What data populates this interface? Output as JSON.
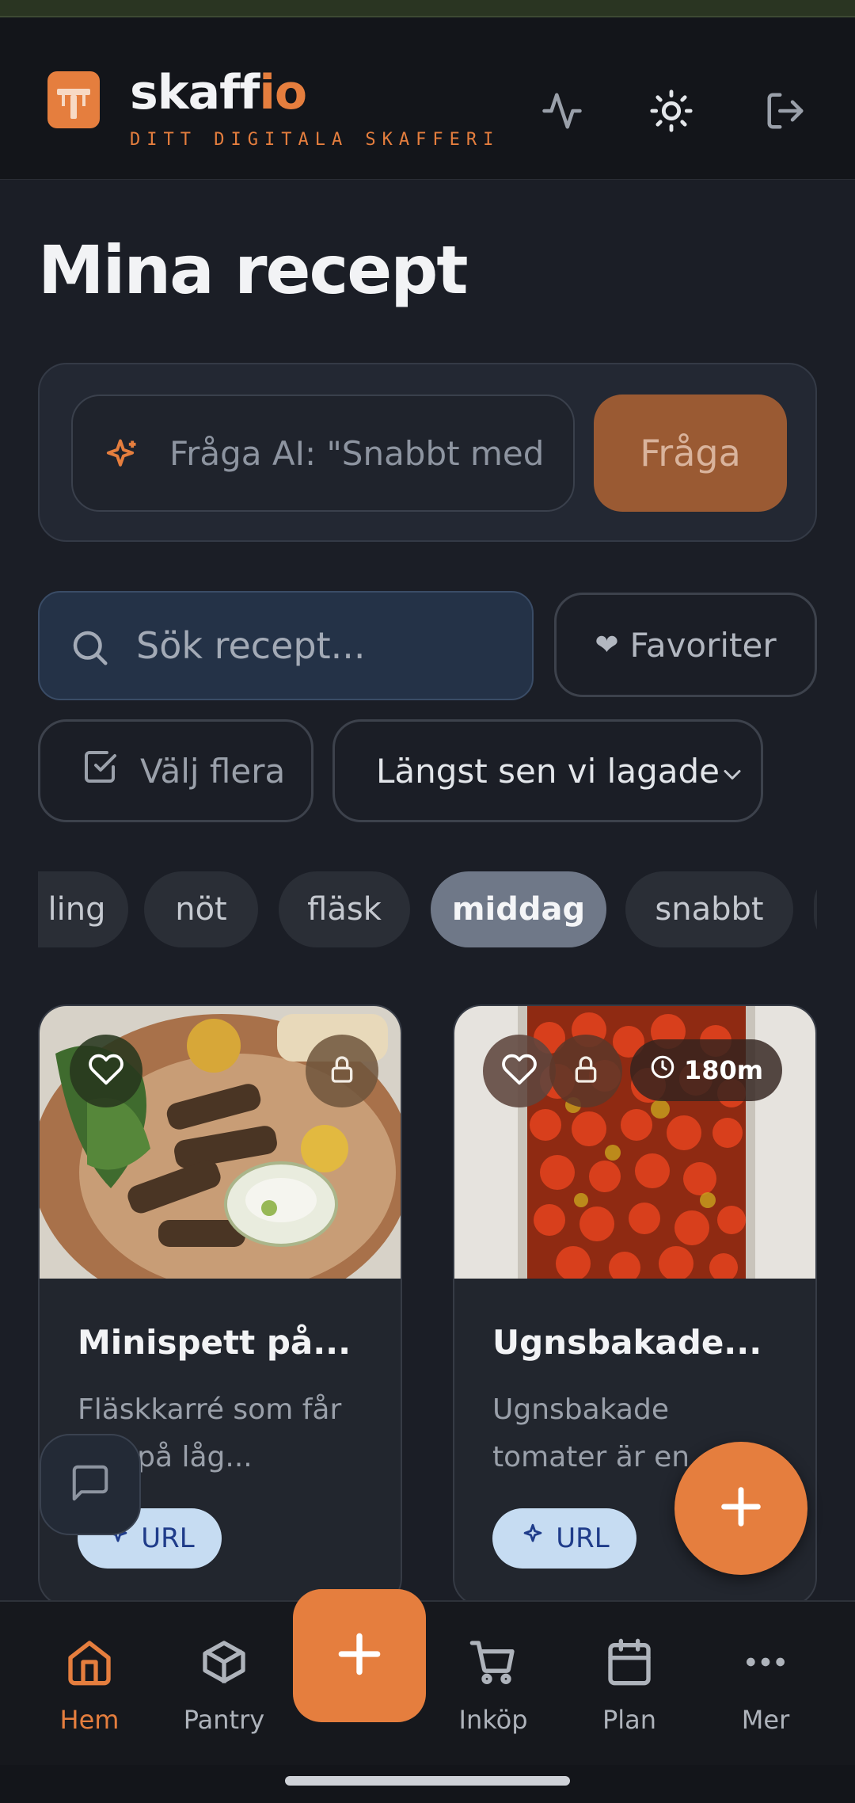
{
  "header": {
    "brand_main": "skaff",
    "brand_accent": "io",
    "tagline": "DITT DIGITALA SKAFFERI",
    "icons": [
      "activity-icon",
      "sun-icon",
      "logout-icon"
    ]
  },
  "page": {
    "title": "Mina recept"
  },
  "ai": {
    "placeholder": "Fråga AI: \"Snabbt med",
    "button_label": "Fråga"
  },
  "search": {
    "placeholder": "Sök recept..."
  },
  "filters": {
    "favorites_label": "Favoriter",
    "select_many_label": "Välj flera",
    "sort_value": "Längst sen vi lagade"
  },
  "chips": [
    "ling",
    "nöt",
    "fläsk",
    "middag",
    "snabbt"
  ],
  "chips_active": "middag",
  "recipes": [
    {
      "title": "Minispett på...",
      "description": "Fläskkarré som får gas på låg...",
      "source": "URL",
      "time": ""
    },
    {
      "title": "Ugnsbakade...",
      "description": "Ugnsbakade tomater är en...",
      "source": "URL",
      "time": "180m"
    }
  ],
  "nav": {
    "items": [
      {
        "label": "Hem",
        "icon": "home-icon"
      },
      {
        "label": "Pantry",
        "icon": "box-icon"
      },
      {
        "label": "Inköp",
        "icon": "cart-icon"
      },
      {
        "label": "Plan",
        "icon": "calendar-icon"
      },
      {
        "label": "Mer",
        "icon": "more-icon"
      }
    ],
    "active": "Hem"
  },
  "colors": {
    "accent": "#e57e3e",
    "background": "#1b1e26",
    "chip_active": "#6f7888",
    "url_badge": "#c6dcf2"
  }
}
